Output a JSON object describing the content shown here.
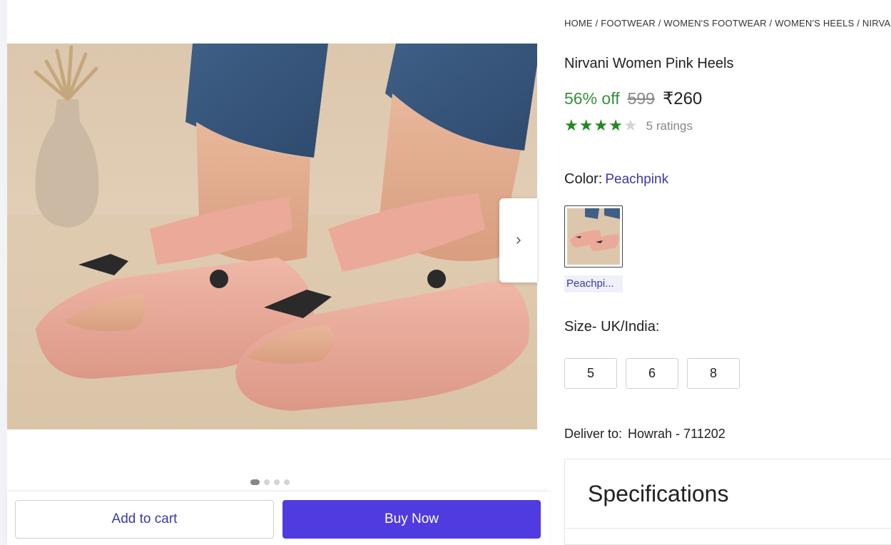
{
  "breadcrumb": {
    "items": [
      "HOME",
      "FOOTWEAR",
      "WOMEN'S FOOTWEAR",
      "WOMEN'S HEELS",
      "NIRVANI"
    ],
    "separator": " / "
  },
  "product": {
    "title": "Nirvani Women Pink Heels",
    "discount": "56% off",
    "mrp": "599",
    "price": "₹260",
    "rating_value": 4,
    "rating_max": 5,
    "ratings_text": "5 ratings"
  },
  "color": {
    "label": "Color:",
    "selected": "Peachpink",
    "swatch_label": "Peachpi..."
  },
  "size": {
    "label": "Size- UK/India:",
    "options": [
      "5",
      "6",
      "8"
    ]
  },
  "delivery": {
    "label": "Deliver to:",
    "location": "Howrah - 711202"
  },
  "specifications": {
    "title": "Specifications"
  },
  "gallery": {
    "image_count": 4,
    "active_index": 0,
    "next_icon": "chevron-right-icon"
  },
  "actions": {
    "add_to_cart": "Add to cart",
    "buy_now": "Buy Now"
  },
  "colors": {
    "accent": "#4f3bdf",
    "link": "#3a3aa6",
    "discount": "#388e3c",
    "star": "#1f8a1f"
  }
}
